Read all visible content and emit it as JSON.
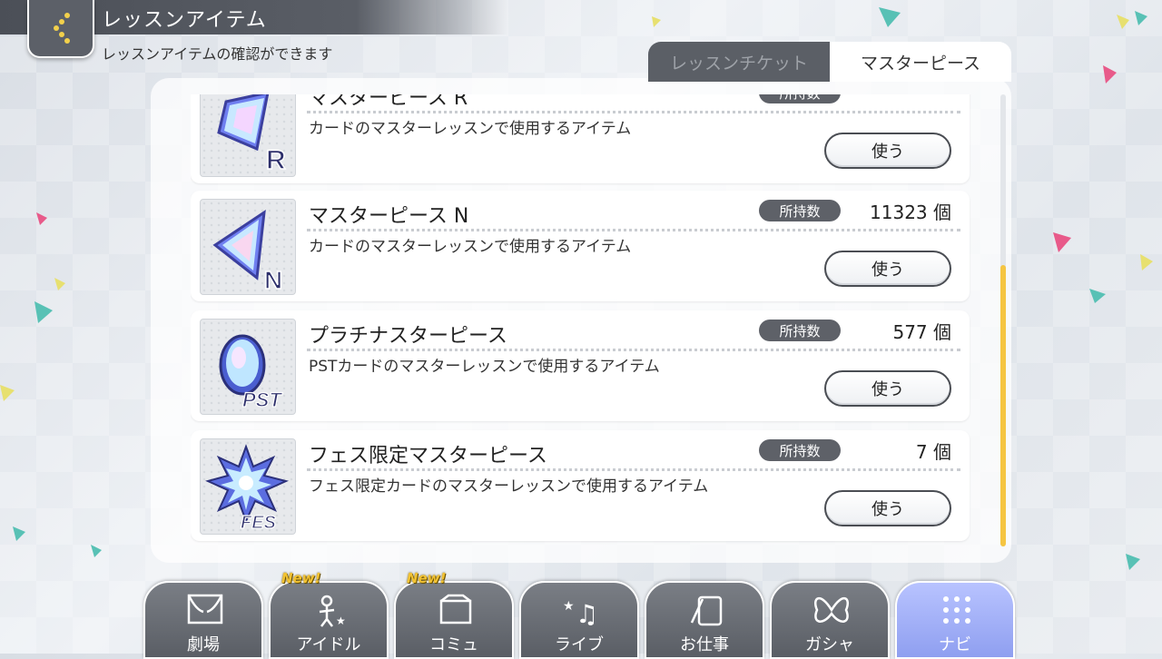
{
  "header": {
    "title": "レッスンアイテム",
    "subtitle": "レッスンアイテムの確認ができます"
  },
  "tabs": [
    {
      "label": "レッスンチケット",
      "active": false
    },
    {
      "label": "マスターピース",
      "active": true
    }
  ],
  "items": [
    {
      "name": "マスターピース R",
      "badge": "所持数",
      "count": "",
      "desc": "カードのマスターレッスンで使用するアイテム",
      "use_label": "使う",
      "icon": "master-piece-r-icon"
    },
    {
      "name": "マスターピース N",
      "badge": "所持数",
      "count": "11323 個",
      "desc": "カードのマスターレッスンで使用するアイテム",
      "use_label": "使う",
      "icon": "master-piece-n-icon"
    },
    {
      "name": "プラチナスターピース",
      "badge": "所持数",
      "count": "577 個",
      "desc": "PSTカードのマスターレッスンで使用するアイテム",
      "use_label": "使う",
      "icon": "platinum-star-piece-icon"
    },
    {
      "name": "フェス限定マスターピース",
      "badge": "所持数",
      "count": "7 個",
      "desc": "フェス限定カードのマスターレッスンで使用するアイテム",
      "use_label": "使う",
      "icon": "fes-master-piece-icon"
    }
  ],
  "nav": [
    {
      "label": "劇場",
      "icon": "theater-icon",
      "new": ""
    },
    {
      "label": "アイドル",
      "icon": "idol-icon",
      "new": "New!"
    },
    {
      "label": "コミュ",
      "icon": "commu-icon",
      "new": "New!"
    },
    {
      "label": "ライブ",
      "icon": "live-icon",
      "new": ""
    },
    {
      "label": "お仕事",
      "icon": "work-icon",
      "new": ""
    },
    {
      "label": "ガシャ",
      "icon": "gacha-icon",
      "new": ""
    },
    {
      "label": "ナビ",
      "icon": "navi-icon",
      "new": "",
      "active": true
    }
  ],
  "colors": {
    "scroll_thumb": "#f5c542",
    "badge_bg": "#5e6168",
    "nav_active": "#a3b0f8"
  }
}
